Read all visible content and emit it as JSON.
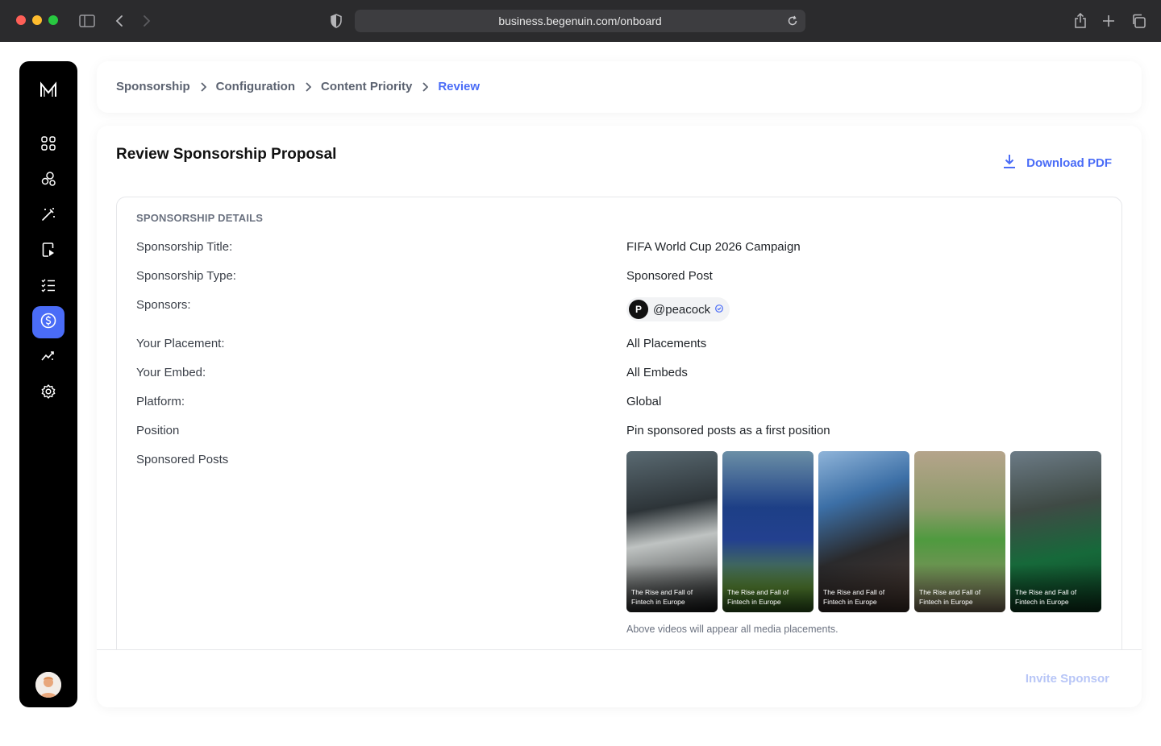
{
  "browser": {
    "url": "business.begenuin.com/onboard"
  },
  "sidebar": {
    "logo": "M",
    "items": [
      {
        "icon": "grid-icon"
      },
      {
        "icon": "community-icon"
      },
      {
        "icon": "magic-wand-icon"
      },
      {
        "icon": "video-page-icon"
      },
      {
        "icon": "checklist-icon"
      },
      {
        "icon": "dollar-icon",
        "active": true
      },
      {
        "icon": "analytics-icon"
      },
      {
        "icon": "settings-icon"
      }
    ]
  },
  "breadcrumb": {
    "items": [
      "Sponsorship",
      "Configuration",
      "Content Priority",
      "Review"
    ]
  },
  "page": {
    "title": "Review Sponsorship Proposal",
    "download_label": "Download PDF"
  },
  "details": {
    "section_title": "SPONSORSHIP DETAILS",
    "rows": [
      {
        "label": "Sponsorship Title:",
        "value": "FIFA World Cup 2026 Campaign"
      },
      {
        "label": "Sponsorship Type:",
        "value": "Sponsored Post"
      },
      {
        "label": "Sponsors:",
        "value": ""
      },
      {
        "label": "Your Placement:",
        "value": "All Placements"
      },
      {
        "label": "Your Embed:",
        "value": "All Embeds"
      },
      {
        "label": "Platform:",
        "value": "Global"
      },
      {
        "label": "Position",
        "value": "Pin sponsored posts as a first position"
      },
      {
        "label": "Sponsored Posts",
        "value": ""
      }
    ],
    "sponsor": {
      "logo_text": "P",
      "handle": "@peacock"
    },
    "posts": [
      {
        "caption": "The Rise and Fall of Fintech in Europe"
      },
      {
        "caption": "The Rise and Fall of Fintech in Europe"
      },
      {
        "caption": "The Rise and Fall of Fintech in Europe"
      },
      {
        "caption": "The Rise and Fall of Fintech in Europe"
      },
      {
        "caption": "The Rise and Fall of Fintech in Europe"
      }
    ],
    "note": "Above videos will appear all media placements."
  },
  "footer": {
    "invite_label": "Invite Sponsor"
  },
  "colors": {
    "accent": "#4a6cf7",
    "sidebar_bg": "#000000",
    "invite_disabled": "#b8c6f7"
  }
}
